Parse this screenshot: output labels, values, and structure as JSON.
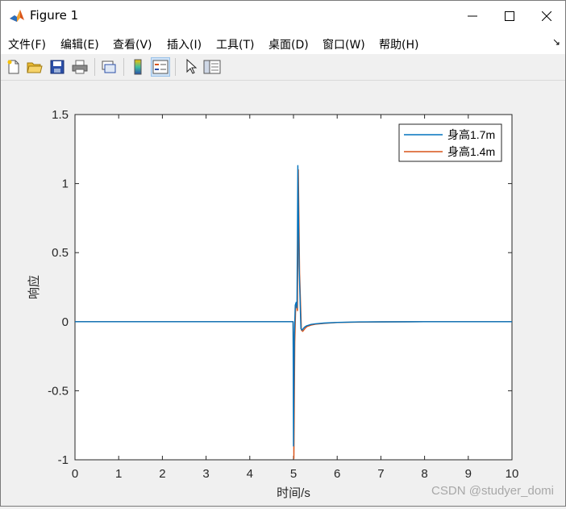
{
  "window": {
    "title": "Figure 1"
  },
  "menu": [
    {
      "label": "文件(F)"
    },
    {
      "label": "编辑(E)"
    },
    {
      "label": "查看(V)"
    },
    {
      "label": "插入(I)"
    },
    {
      "label": "工具(T)"
    },
    {
      "label": "桌面(D)"
    },
    {
      "label": "窗口(W)"
    },
    {
      "label": "帮助(H)"
    }
  ],
  "toolbar": {
    "icons": [
      "new-figure-icon",
      "open-file-icon",
      "save-icon",
      "print-icon",
      "link-plot-icon",
      "colorbar-icon",
      "legend-icon",
      "pointer-icon",
      "property-inspector-icon"
    ]
  },
  "chart_data": {
    "type": "line",
    "xlabel": "时间/s",
    "ylabel": "响应",
    "xlim": [
      0,
      10
    ],
    "ylim": [
      -1,
      1.5
    ],
    "xticks": [
      "0",
      "1",
      "2",
      "3",
      "4",
      "5",
      "6",
      "7",
      "8",
      "9",
      "10"
    ],
    "yticks": [
      "-1",
      "-0.5",
      "0",
      "0.5",
      "1",
      "1.5"
    ],
    "grid": false,
    "legend_position": "top-right",
    "series": [
      {
        "name": "身高1.7m",
        "color": "#0072BD",
        "x": [
          0,
          4.99,
          5.0,
          5.02,
          5.04,
          5.06,
          5.08,
          5.09,
          5.1,
          5.13,
          5.17,
          5.2,
          5.25,
          5.3,
          5.4,
          5.5,
          5.7,
          6.0,
          6.5,
          7.0,
          8.0,
          10.0
        ],
        "y": [
          0,
          0,
          -0.9,
          -0.1,
          0.12,
          0.14,
          0.1,
          0.6,
          1.13,
          0.4,
          -0.05,
          -0.06,
          -0.04,
          -0.03,
          -0.02,
          -0.015,
          -0.01,
          -0.005,
          -0.002,
          -0.001,
          0,
          0
        ]
      },
      {
        "name": "身高1.4m",
        "color": "#D95319",
        "x": [
          0,
          4.99,
          5.01,
          5.03,
          5.05,
          5.07,
          5.09,
          5.1,
          5.11,
          5.14,
          5.18,
          5.21,
          5.26,
          5.31,
          5.4,
          5.5,
          5.7,
          6.0,
          6.5,
          7.0,
          8.0,
          10.0
        ],
        "y": [
          0,
          0,
          -0.99,
          -0.15,
          0.1,
          0.13,
          0.08,
          0.5,
          1.1,
          0.35,
          -0.06,
          -0.07,
          -0.05,
          -0.035,
          -0.025,
          -0.018,
          -0.012,
          -0.006,
          -0.003,
          -0.001,
          0,
          0
        ]
      }
    ]
  },
  "watermark": "CSDN @studyer_domi"
}
